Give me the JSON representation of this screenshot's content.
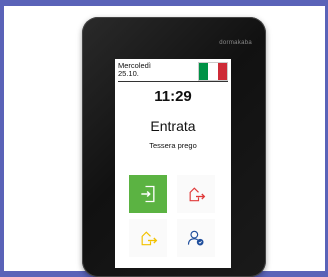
{
  "device": {
    "brand": "dormakaba"
  },
  "screen": {
    "day": "Mercoledì",
    "date": "25.10.",
    "flag_colors": [
      "#009246",
      "#ffffff",
      "#ce2b37"
    ],
    "time": "11:29",
    "mode": "Entrata",
    "prompt": "Tessera prego"
  },
  "buttons": [
    {
      "icon": "enter-icon",
      "active": true,
      "color": "#ffffff"
    },
    {
      "icon": "exit-icon",
      "active": false,
      "color": "#e03a3a"
    },
    {
      "icon": "pause-icon",
      "active": false,
      "color": "#f2c200"
    },
    {
      "icon": "user-info-icon",
      "active": false,
      "color": "#1f4e9c"
    }
  ],
  "colors": {
    "active_green": "#5bb342"
  }
}
